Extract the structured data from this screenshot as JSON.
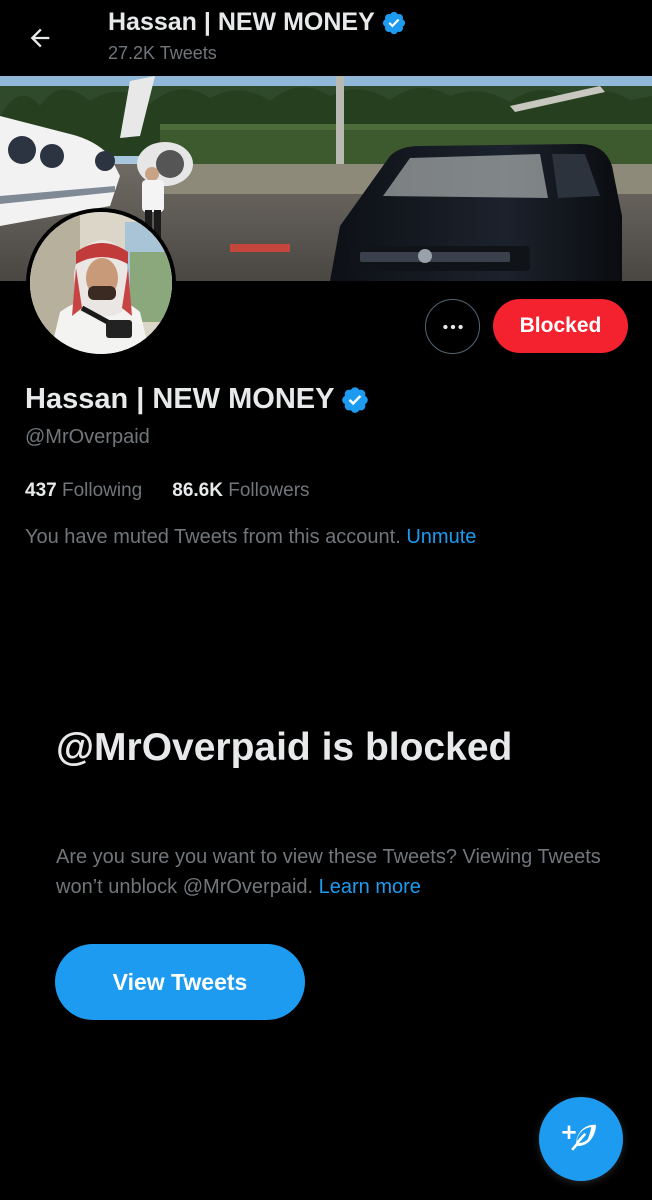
{
  "header": {
    "title": "Hassan | NEW MONEY",
    "subtitle": "27.2K Tweets"
  },
  "profile": {
    "name": "Hassan | NEW MONEY",
    "handle": "@MrOverpaid",
    "verified": true,
    "following_count": "437",
    "following_label": "Following",
    "followers_count": "86.6K",
    "followers_label": "Followers"
  },
  "actions": {
    "blocked_label": "Blocked"
  },
  "muted_notice": {
    "text": "You have muted Tweets from this account.",
    "unmute_label": "Unmute"
  },
  "blocked_panel": {
    "title": "@MrOverpaid is blocked",
    "description": "Are you sure you want to view these Tweets? Viewing Tweets won’t unblock @MrOverpaid.",
    "learn_more_label": "Learn more",
    "view_button_label": "View Tweets"
  },
  "icons": {
    "back": "arrow-left-icon",
    "verified": "verified-badge-icon",
    "more": "more-icon",
    "compose": "compose-tweet-icon"
  },
  "colors": {
    "accent": "#1d9bf0",
    "blocked": "#f4212e",
    "background": "#000000",
    "muted_text": "#71767b"
  }
}
